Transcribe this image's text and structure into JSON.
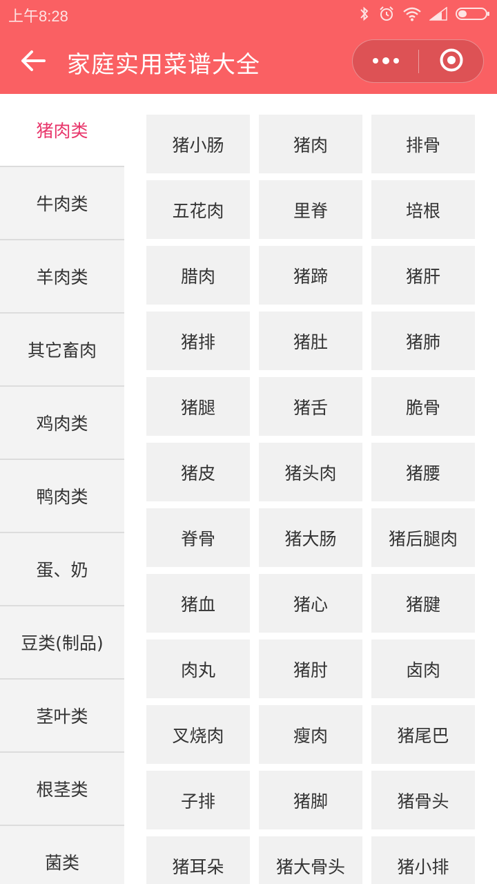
{
  "status_bar": {
    "time": "上午8:28",
    "icons": [
      "bluetooth-icon",
      "alarm-icon",
      "wifi-icon",
      "signal-icon",
      "battery-icon"
    ]
  },
  "nav": {
    "title": "家庭实用菜谱大全",
    "back_icon": "back-arrow-icon",
    "more_icon": "more-dots-icon",
    "close_icon": "close-target-icon"
  },
  "colors": {
    "header_bg": "#fa6063",
    "active_text": "#e8366b",
    "sidebar_bg": "#f3f3f3",
    "cell_bg": "#f1f1f1"
  },
  "sidebar": {
    "items": [
      {
        "label": "猪肉类",
        "active": true
      },
      {
        "label": "牛肉类",
        "active": false
      },
      {
        "label": "羊肉类",
        "active": false
      },
      {
        "label": "其它畜肉",
        "active": false
      },
      {
        "label": "鸡肉类",
        "active": false
      },
      {
        "label": "鸭肉类",
        "active": false
      },
      {
        "label": "蛋、奶",
        "active": false
      },
      {
        "label": "豆类(制品)",
        "active": false
      },
      {
        "label": "茎叶类",
        "active": false
      },
      {
        "label": "根茎类",
        "active": false
      },
      {
        "label": "菌类",
        "active": false
      }
    ]
  },
  "grid": {
    "items": [
      "猪小肠",
      "猪肉",
      "排骨",
      "五花肉",
      "里脊",
      "培根",
      "腊肉",
      "猪蹄",
      "猪肝",
      "猪排",
      "猪肚",
      "猪肺",
      "猪腿",
      "猪舌",
      "脆骨",
      "猪皮",
      "猪头肉",
      "猪腰",
      "脊骨",
      "猪大肠",
      "猪后腿肉",
      "猪血",
      "猪心",
      "猪腱",
      "肉丸",
      "猪肘",
      "卤肉",
      "叉烧肉",
      "瘦肉",
      "猪尾巴",
      "子排",
      "猪脚",
      "猪骨头",
      "猪耳朵",
      "猪大骨头",
      "猪小排"
    ]
  }
}
